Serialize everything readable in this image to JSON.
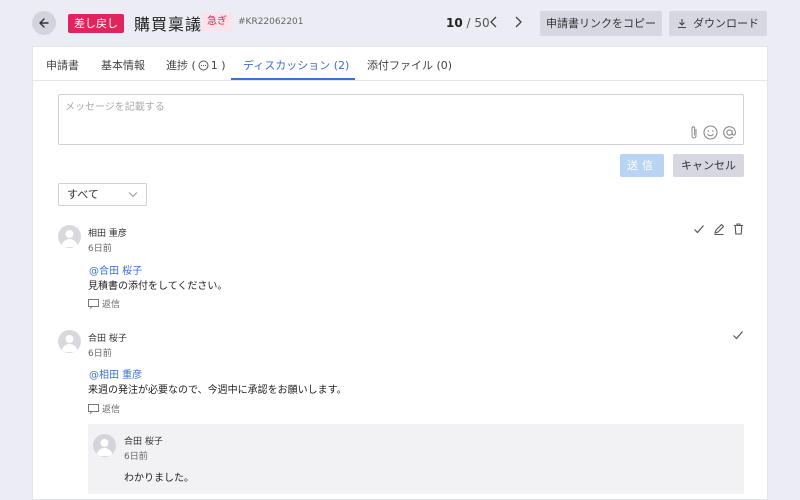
{
  "header": {
    "status_badge": "差し戻し",
    "title": "購買稟議",
    "urgency_badge": "急ぎ",
    "doc_code": "#KR22062201",
    "pager": {
      "current": "10",
      "separator": "/",
      "total": "50"
    },
    "copy_link_label": "申請書リンクをコピー",
    "download_label": "ダウンロード"
  },
  "tabs": [
    {
      "label": "申請書"
    },
    {
      "label": "基本情報"
    },
    {
      "label": "進捗 (",
      "suffix": "1 )"
    },
    {
      "label": "ディスカッション (2)"
    },
    {
      "label": "添付ファイル (0)"
    }
  ],
  "composer": {
    "placeholder": "メッセージを記載する",
    "send_label": "送信",
    "cancel_label": "キャンセル"
  },
  "filter": {
    "selected": "すべて"
  },
  "comments": [
    {
      "author": "相田 重彦",
      "time": "6日前",
      "mention": "@合田 桜子",
      "body": "見積書の添付をしてください。",
      "reply_label": "返信"
    },
    {
      "author": "合田 桜子",
      "time": "6日前",
      "mention": "@相田 重彦",
      "body": "来週の発注が必要なので、今週中に承認をお願いします。",
      "reply_label": "返信",
      "replies": [
        {
          "author": "合田 桜子",
          "time": "6日前",
          "body": "わかりました。"
        }
      ]
    }
  ],
  "colors": {
    "accent": "#3a6fd4",
    "status": "#e0245e",
    "urgent_bg": "#fbe3ea"
  },
  "icons": [
    "back-arrow-icon",
    "chevron-left-icon",
    "chevron-right-icon",
    "download-icon",
    "paperclip-icon",
    "emoji-icon",
    "at-icon",
    "chevron-down-icon",
    "check-icon",
    "edit-icon",
    "trash-icon",
    "reply-icon",
    "avatar-icon",
    "chat-bubble-icon"
  ]
}
